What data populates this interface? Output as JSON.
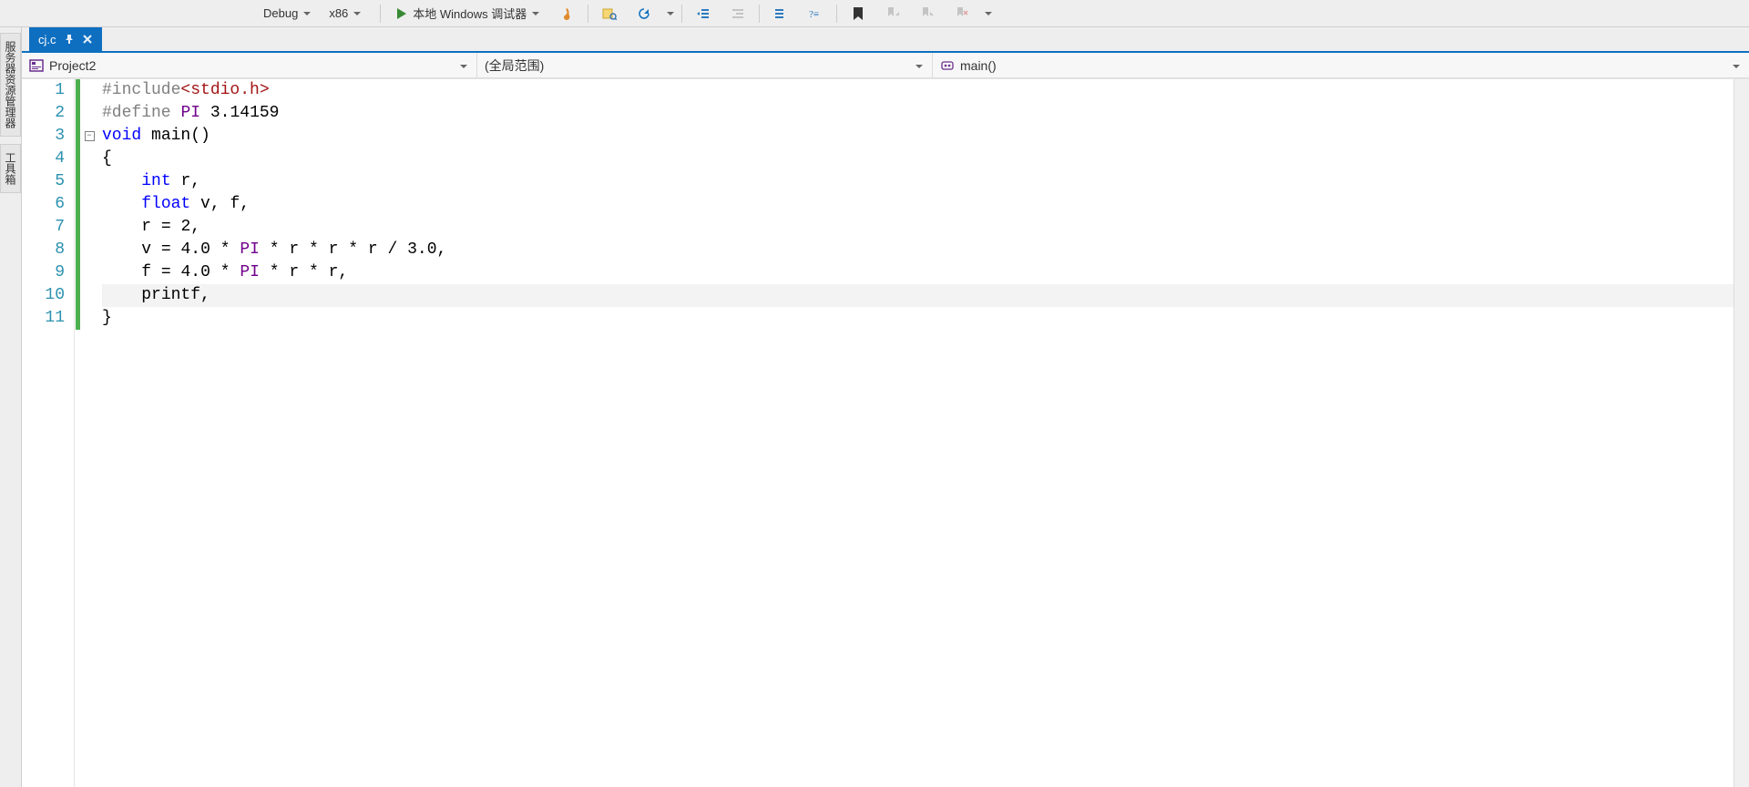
{
  "toolbar": {
    "config_label": "Debug",
    "platform_label": "x86",
    "debug_label": "本地 Windows 调试器"
  },
  "side_tabs": {
    "explorer_label": "服务器资源管理器",
    "toolbox_label": "工具箱"
  },
  "file_tab": {
    "name": "cj.c"
  },
  "nav": {
    "project_label": "Project2",
    "scope_label": "(全局范围)",
    "member_label": "main()"
  },
  "code": {
    "lines": [
      {
        "n": 1,
        "fold": "",
        "html": "<span class='tok-pp'>#include</span><span class='tok-inc'>&lt;stdio.h&gt;</span>"
      },
      {
        "n": 2,
        "fold": "",
        "html": "<span class='tok-pp'>#define</span> <span class='tok-mac-def'>PI</span> <span class='tok-num'>3.14159</span>"
      },
      {
        "n": 3,
        "fold": "minus",
        "html": "<span class='tok-kw'>void</span> <span class='tok-id'>main</span><span class='tok-punc'>()</span>"
      },
      {
        "n": 4,
        "fold": "",
        "html": "<span class='tok-punc'>{</span>"
      },
      {
        "n": 5,
        "fold": "",
        "html": "    <span class='tok-kw'>int</span> <span class='tok-id'>r</span><span class='tok-punc'>,</span>"
      },
      {
        "n": 6,
        "fold": "",
        "html": "    <span class='tok-kw'>float</span> <span class='tok-id'>v</span><span class='tok-punc'>,</span> <span class='tok-id'>f</span><span class='tok-punc'>,</span>"
      },
      {
        "n": 7,
        "fold": "",
        "html": "    <span class='tok-id'>r</span> <span class='tok-punc'>=</span> <span class='tok-num'>2</span><span class='tok-punc'>,</span>"
      },
      {
        "n": 8,
        "fold": "",
        "html": "    <span class='tok-id'>v</span> <span class='tok-punc'>=</span> <span class='tok-num'>4.0</span> <span class='tok-punc'>*</span> <span class='tok-mac'>PI</span> <span class='tok-punc'>*</span> <span class='tok-id'>r</span> <span class='tok-punc'>*</span> <span class='tok-id'>r</span> <span class='tok-punc'>*</span> <span class='tok-id'>r</span> <span class='tok-punc'>/</span> <span class='tok-num'>3.0</span><span class='tok-punc'>,</span>"
      },
      {
        "n": 9,
        "fold": "",
        "html": "    <span class='tok-id'>f</span> <span class='tok-punc'>=</span> <span class='tok-num'>4.0</span> <span class='tok-punc'>*</span> <span class='tok-mac'>PI</span> <span class='tok-punc'>*</span> <span class='tok-id'>r</span> <span class='tok-punc'>*</span> <span class='tok-id'>r</span><span class='tok-punc'>,</span>"
      },
      {
        "n": 10,
        "fold": "",
        "html": "    <span class='tok-id'>printf</span><span class='tok-punc'>,</span>",
        "caret": true
      },
      {
        "n": 11,
        "fold": "",
        "html": "<span class='tok-punc'>}</span>"
      }
    ]
  }
}
